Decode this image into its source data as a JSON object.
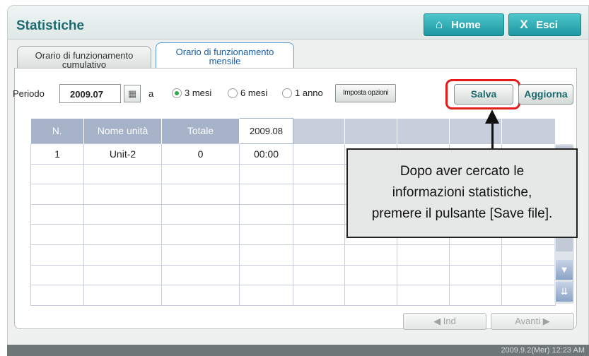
{
  "header": {
    "title": "Statistiche",
    "home_label": "Home",
    "exit_label": "Esci",
    "home_icon": "home-icon",
    "exit_icon": "close-icon"
  },
  "tabs": [
    {
      "label_line1": "Orario di funzionamento",
      "label_line2": "cumulativo",
      "active": false
    },
    {
      "label_line1": "Orario di funzionamento",
      "label_line2": "mensile",
      "active": true
    }
  ],
  "toolbar": {
    "period_label": "Periodo",
    "date_value": "2009.07",
    "to_label": "a",
    "radio_3": "3 mesi",
    "radio_6": "6 mesi",
    "radio_1": "1 anno",
    "selected_range": "3 mesi",
    "options_label": "Imposta opzioni",
    "save_label": "Salva",
    "refresh_label": "Aggiorna"
  },
  "table": {
    "headers": [
      "N.",
      "Nome unità",
      "Totale",
      "2009.08"
    ],
    "rows": [
      [
        "1",
        "Unit-2",
        "0",
        "00:00"
      ]
    ]
  },
  "callout": {
    "line1": "Dopo aver cercato le",
    "line2": "informazioni statistiche,",
    "line3": "premere il pulsante [Save file]."
  },
  "pager": {
    "prev_label": "◀  Ind",
    "next_label": "Avanti  ▶"
  },
  "status": {
    "datetime": "2009.9.2(Mer)  12:23 AM"
  },
  "colors": {
    "accent": "#1d97a0",
    "highlight": "#e31b1b",
    "grid_header": "#a6b2c7"
  }
}
